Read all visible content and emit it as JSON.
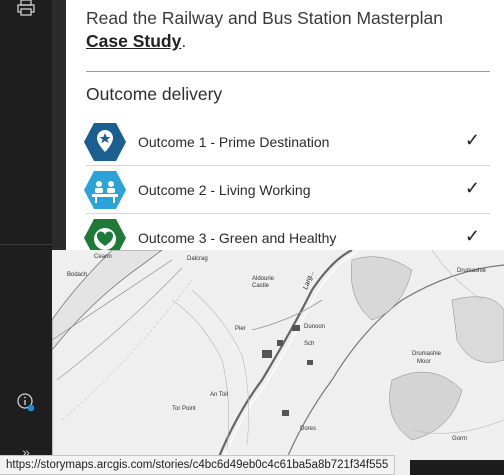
{
  "panel": {
    "intro_text": "Read the Railway and Bus Station Masterplan",
    "intro_link": "Case Study",
    "intro_after": ".",
    "heading": "Outcome delivery",
    "outcomes": [
      {
        "label": "Outcome 1 - Prime Destination",
        "check": "✓",
        "color": "#1a5f8f",
        "icon": "map-pin-star-icon"
      },
      {
        "label": "Outcome 2 - Living Working",
        "check": "✓",
        "color": "#2ba3d8",
        "icon": "people-icon"
      },
      {
        "label": "Outcome 3 - Green and Healthy",
        "check": "✓",
        "color": "#1f7a3a",
        "icon": "heart-leaf-icon"
      }
    ]
  },
  "toolbar": {
    "print_icon": "print-icon",
    "info_icon": "info-icon",
    "expand_glyph": "»"
  },
  "map": {
    "labels": [
      "Larg...",
      "Pier",
      "Dunoon",
      "Sch",
      "Tor Point",
      "Drumashie Moor",
      "Drumashie",
      "Dores",
      "Aldourie Castle",
      "An Toll",
      "Bodach",
      "Gorm",
      "Ceann",
      "Dalcrag"
    ]
  },
  "status": {
    "url": "https://storymaps.arcgis.com/stories/c4bc6d49eb0c4c61ba5a8b721f34f555"
  }
}
